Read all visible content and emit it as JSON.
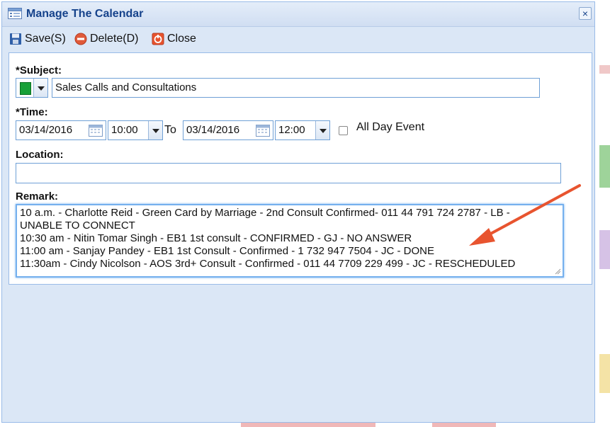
{
  "window": {
    "title": "Manage The Calendar",
    "close_glyph": "×"
  },
  "toolbar": {
    "save_label": "Save(S)",
    "delete_label": "Delete(D)",
    "close_label": "Close"
  },
  "form": {
    "subject": {
      "label": "*Subject:",
      "color_value": "#18a038",
      "value": "Sales Calls and Consultations"
    },
    "time": {
      "label": "*Time:",
      "start_date": "03/14/2016",
      "start_time": "10:00",
      "to_label": "To",
      "end_date": "03/14/2016",
      "end_time": "12:00",
      "all_day_label": "All Day Event",
      "all_day_checked": false
    },
    "location": {
      "label": "Location:",
      "value": ""
    },
    "remark": {
      "label": "Remark:",
      "lines": [
        "10 a.m. - Charlotte Reid - Green Card by Marriage - 2nd Consult Confirmed- 011 44 791 724 2787 - LB -",
        "UNABLE TO CONNECT",
        "10:30 am - Nitin Tomar Singh - EB1 1st consult - CONFIRMED  - GJ - NO ANSWER",
        "11:00 am - Sanjay Pandey - EB1 1st Consult - Confirmed - 1 732 947 7504 - JC  - DONE",
        "11:30am - Cindy Nicolson - AOS 3rd+ Consult - Confirmed - 011 44 7709 229 499 - JC - RESCHEDULED"
      ]
    }
  },
  "colors": {
    "title_text": "#15428b",
    "annotation_arrow": "#e8542f",
    "field_border": "#6fa0d6"
  }
}
